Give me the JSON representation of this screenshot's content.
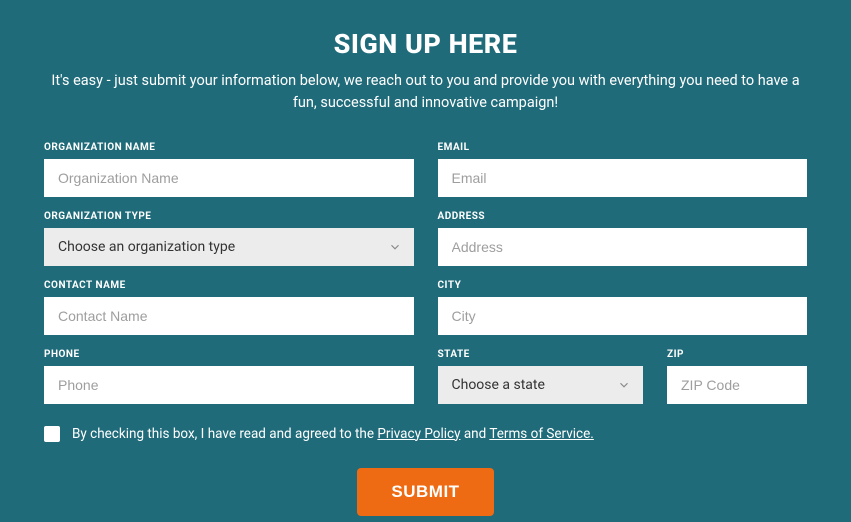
{
  "header": {
    "title": "SIGN UP HERE",
    "subtitle": "It's easy - just submit your information below, we reach out to you and provide you with everything you need to have a fun, successful and innovative campaign!"
  },
  "left": {
    "org_name_label": "ORGANIZATION NAME",
    "org_name_placeholder": "Organization Name",
    "org_type_label": "ORGANIZATION TYPE",
    "org_type_selected": "Choose an organization type",
    "contact_name_label": "CONTACT NAME",
    "contact_name_placeholder": "Contact Name",
    "phone_label": "PHONE",
    "phone_placeholder": "Phone"
  },
  "right": {
    "email_label": "EMAIL",
    "email_placeholder": "Email",
    "address_label": "ADDRESS",
    "address_placeholder": "Address",
    "city_label": "CITY",
    "city_placeholder": "City",
    "state_label": "STATE",
    "state_selected": "Choose a state",
    "zip_label": "ZIP",
    "zip_placeholder": "ZIP Code"
  },
  "consent": {
    "prefix": "By checking this box, I have read and agreed to the ",
    "privacy": "Privacy Policy",
    "mid": " and ",
    "terms": "Terms of Service.",
    "checked": false
  },
  "submit_label": "SUBMIT"
}
